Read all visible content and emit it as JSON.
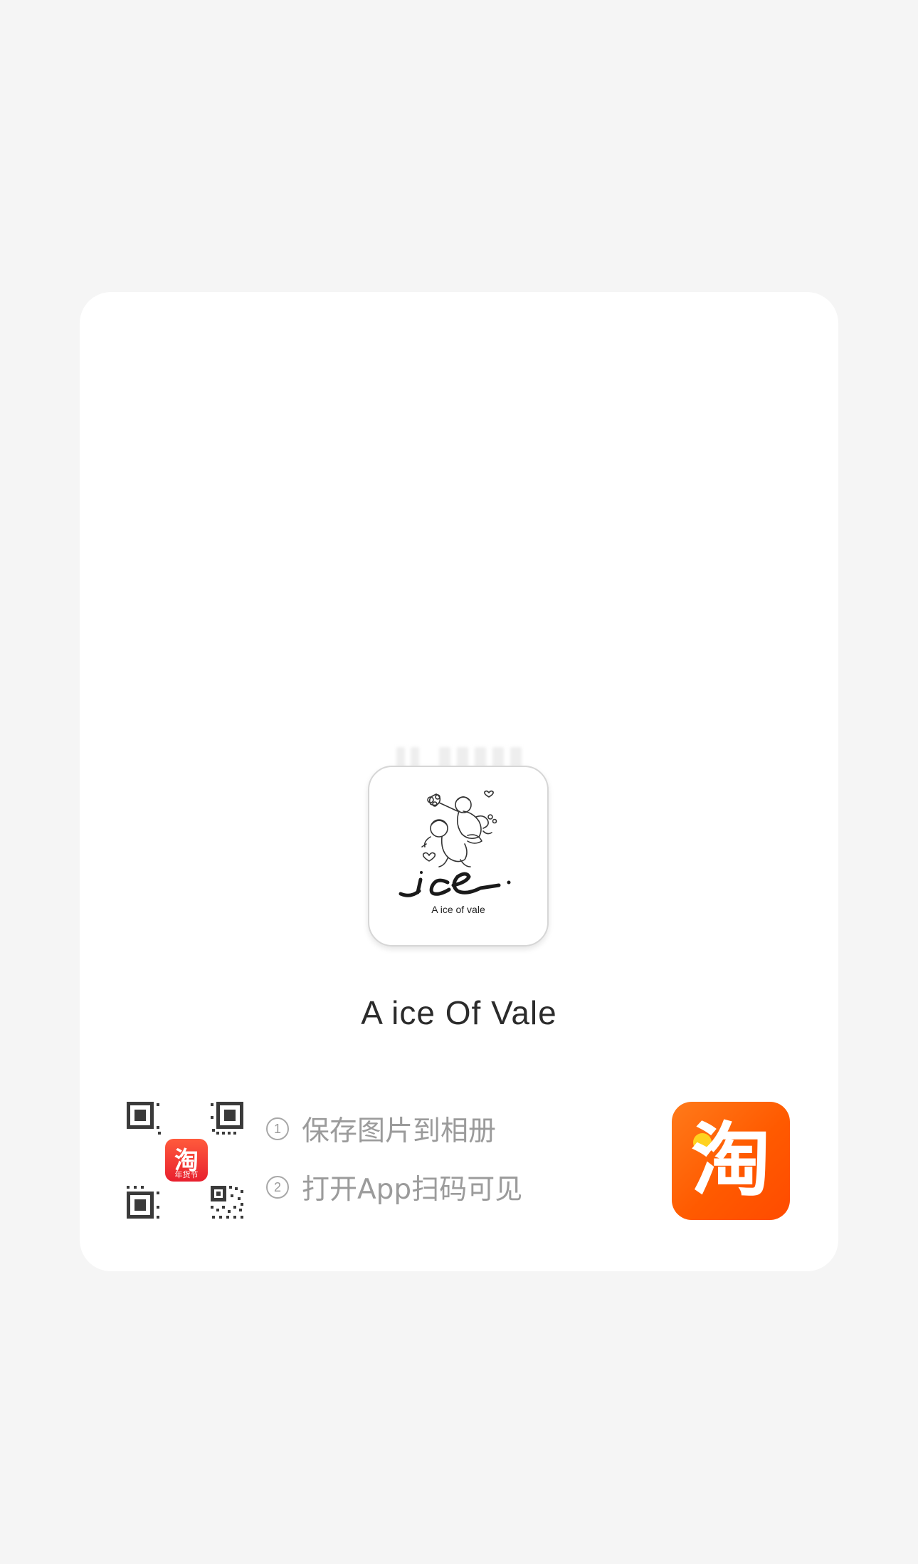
{
  "card": {
    "shop_logo": {
      "wordmark": "ice",
      "subtitle": "A ice of vale",
      "icon": "angel-illustration-logo"
    },
    "shop_name": "A ice Of Vale",
    "qr_code": {
      "icon": "qr-code-icon",
      "badge_char": "淘",
      "badge_text": "年货节"
    },
    "steps": [
      {
        "number": "1",
        "text": "保存图片到相册"
      },
      {
        "number": "2",
        "text": "打开App扫码可见"
      }
    ],
    "app_icon": {
      "char": "淘",
      "name": "taobao-app-icon"
    }
  },
  "colors": {
    "background": "#f5f5f5",
    "card": "#ffffff",
    "taobao_orange": "#ff5a00",
    "badge_red": "#e8202e",
    "step_text": "#9b9b9b"
  }
}
